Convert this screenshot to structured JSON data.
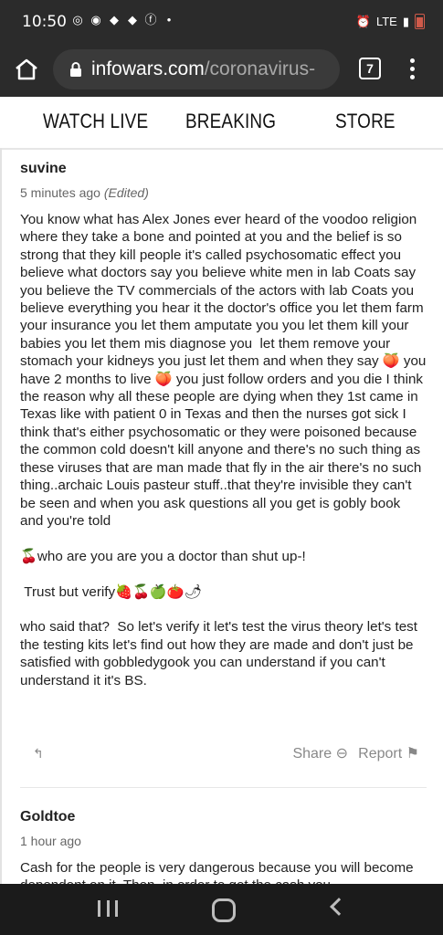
{
  "status": {
    "time": "10:50",
    "network": "LTE"
  },
  "browser": {
    "url_host": "infowars.com",
    "url_path": "/coronavirus-",
    "tab_count": "7"
  },
  "site_nav": {
    "items": [
      "WATCH LIVE",
      "BREAKING",
      "STORE"
    ]
  },
  "comments": [
    {
      "author": "suvine",
      "time": "5 minutes ago",
      "edited": "(Edited)",
      "body": "You know what has Alex Jones ever heard of the voodoo religion where they take a bone and pointed at you and the belief is so strong that they kill people it's called psychosomatic effect you believe what doctors say you believe white men in lab Coats say you believe the TV commercials of the actors with lab Coats you believe everything you hear it the doctor's office you let them farm your insurance you let them amputate you you let them kill your babies you let them mis diagnose you  let them remove your stomach your kidneys you just let them and when they say 🍑 you have 2 months to live 🍑 you just follow orders and you die I think the reason why all these people are dying when they 1st came in Texas like with patient 0 in Texas and then the nurses got sick I think that's either psychosomatic or they were poisoned because the common cold doesn't kill anyone and there's no such thing as these viruses that are man made that fly in the air there's no such thing..archaic Louis pasteur stuff..that they're invisible they can't be seen and when you ask questions all you get is gobly book and you're told\n\n🍒who are you are you a doctor than shut up-!\n\n Trust but verify🍓🍒🍏🍅🌶\n\nwho said that?  So let's verify it let's test the virus theory let's test the testing kits let's find out how they are made and don't just be satisfied with gobbledygook you can understand if you can't understand it it's BS.",
      "share_label": "Share",
      "report_label": "Report"
    },
    {
      "author": "Goldtoe",
      "time": "1 hour ago",
      "body": "Cash for the people is very dangerous because you will become dependent on it. Then, in order to get the cash you"
    }
  ]
}
